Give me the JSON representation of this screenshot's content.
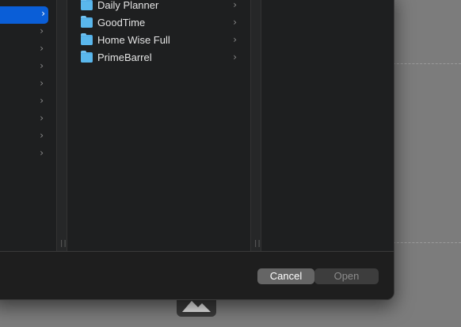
{
  "sidebar": {
    "rows": [
      {
        "selected": false
      },
      {
        "selected": true
      },
      {
        "selected": false
      },
      {
        "selected": false
      },
      {
        "selected": false
      },
      {
        "selected": false
      },
      {
        "selected": false
      },
      {
        "selected": false
      },
      {
        "selected": false
      },
      {
        "selected": false
      }
    ],
    "chevron": "›"
  },
  "folders": [
    {
      "name": "Daily Planner",
      "icon": "folder-icon"
    },
    {
      "name": "GoodTime",
      "icon": "folder-icon"
    },
    {
      "name": "Home Wise Full",
      "icon": "folder-icon"
    },
    {
      "name": "PrimeBarrel",
      "icon": "folder-icon"
    }
  ],
  "footer": {
    "cancel_label": "Cancel",
    "open_label": "Open"
  },
  "colors": {
    "selection": "#0a5ed7",
    "folder": "#5ab7ec",
    "dialog_bg": "#1e1e1e",
    "backdrop": "#7c7c7c"
  }
}
